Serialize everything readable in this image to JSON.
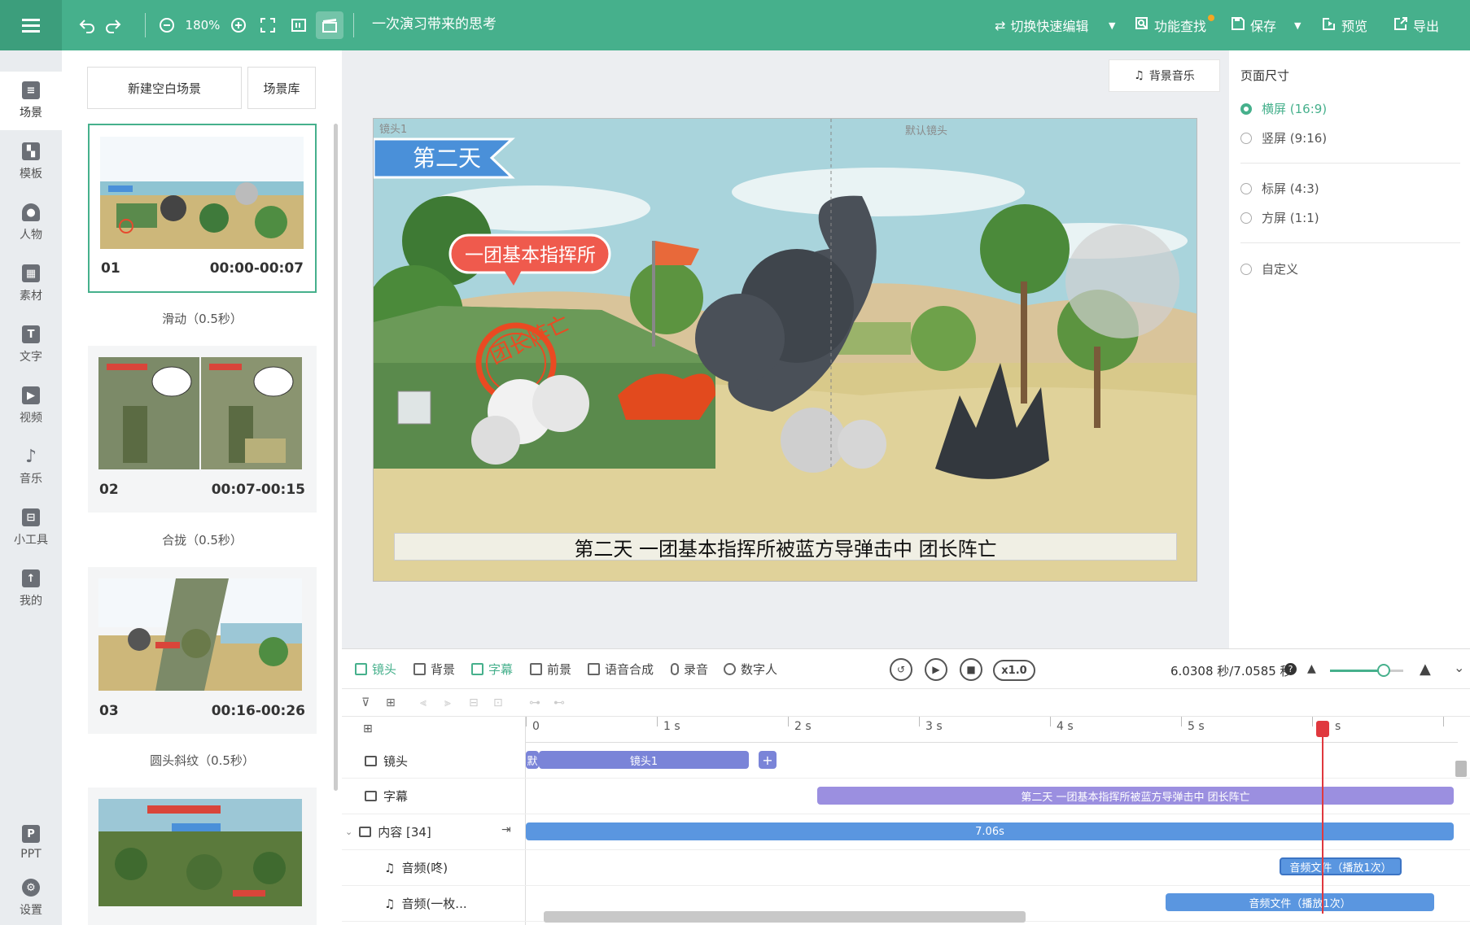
{
  "toolbar": {
    "zoom": "180%",
    "doc_title": "一次演习带来的思考",
    "quick_edit": "切换快速编辑",
    "find": "功能查找",
    "save": "保存",
    "preview": "预览",
    "export": "导出",
    "accent": "#46b08c"
  },
  "nav": [
    {
      "label": "场景",
      "icon": "scene-icon"
    },
    {
      "label": "模板",
      "icon": "template-icon"
    },
    {
      "label": "人物",
      "icon": "person-icon"
    },
    {
      "label": "素材",
      "icon": "material-icon"
    },
    {
      "label": "文字",
      "icon": "text-icon"
    },
    {
      "label": "视频",
      "icon": "video-icon"
    },
    {
      "label": "音乐",
      "icon": "music-icon"
    },
    {
      "label": "小工具",
      "icon": "toolbox-icon"
    },
    {
      "label": "我的",
      "icon": "mine-icon"
    },
    {
      "label": "PPT",
      "icon": "ppt-icon"
    },
    {
      "label": "设置",
      "icon": "settings-icon"
    }
  ],
  "scenes": {
    "new_blank": "新建空白场景",
    "library": "场景库",
    "items": [
      {
        "num": "01",
        "time": "00:00-00:07",
        "transition": "滑动（0.5秒）"
      },
      {
        "num": "02",
        "time": "00:07-00:15",
        "transition": "合拢（0.5秒）"
      },
      {
        "num": "03",
        "time": "00:16-00:26",
        "transition": "圆头斜纹（0.5秒）"
      }
    ]
  },
  "canvas": {
    "bgm": "背景音乐",
    "lens1": "镜头1",
    "default_lens": "默认镜头",
    "banner": "第二天",
    "hq_label": "一团基本指挥所",
    "stamp": "团长阵亡",
    "subtitle": "第二天 一团基本指挥所被蓝方导弹击中 团长阵亡"
  },
  "page_size": {
    "title": "页面尺寸",
    "options": [
      {
        "label": "横屏 (16:9)",
        "selected": true
      },
      {
        "label": "竖屏 (9:16)",
        "selected": false
      },
      {
        "label": "标屏 (4:3)",
        "selected": false
      },
      {
        "label": "方屏 (1:1)",
        "selected": false
      },
      {
        "label": "自定义",
        "selected": false
      }
    ]
  },
  "timeline": {
    "tools": [
      "镜头",
      "背景",
      "字幕",
      "前景",
      "语音合成",
      "录音",
      "数字人"
    ],
    "speed": "x1.0",
    "time_readout": "6.0308 秒/7.0585 秒",
    "ticks": [
      "0",
      "1 s",
      "2 s",
      "3 s",
      "4 s",
      "5 s",
      "s"
    ],
    "rows": {
      "lens": "镜头",
      "subtitle": "字幕",
      "content": "内容 [34]",
      "audio1": "音频(咚)",
      "audio2": "音频(一枚..."
    },
    "clips": {
      "default_short": "默",
      "lens1": "镜头1",
      "add": "+",
      "subtitle_text": "第二天 一团基本指挥所被蓝方导弹击中 团长阵亡",
      "content_duration": "7.06s",
      "audio1_clip": "音频文件（播放1次）",
      "audio2_clip": "音频文件（播放1次）"
    }
  }
}
